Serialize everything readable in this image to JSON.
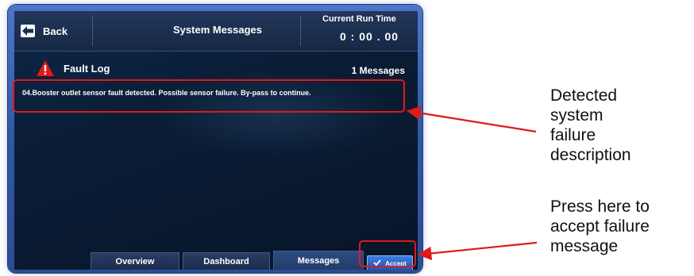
{
  "topbar": {
    "back_label": "Back",
    "title": "System Messages",
    "runtime_label": "Current Run Time",
    "runtime_value": "0 : 00 . 00"
  },
  "fault_log": {
    "title": "Fault Log",
    "count": "1 Messages",
    "messages": [
      "04.Booster outlet sensor fault detected. Possible sensor failure. By-pass to continue."
    ]
  },
  "nav": {
    "tabs": [
      "Overview",
      "Dashboard",
      "Messages"
    ],
    "active_tab": "Messages",
    "accept_label": "Accept"
  },
  "annotations": {
    "callout_1": [
      "Detected",
      "system",
      "failure",
      "description"
    ],
    "callout_2": [
      "Press here to",
      "accept failure",
      "message"
    ],
    "highlight_color": "#e1191b"
  },
  "colors": {
    "bezel": "#3a63b8",
    "screen_bg": "#0a1d36",
    "warning": "#e1191b",
    "accept_button": "#2a66cc"
  }
}
